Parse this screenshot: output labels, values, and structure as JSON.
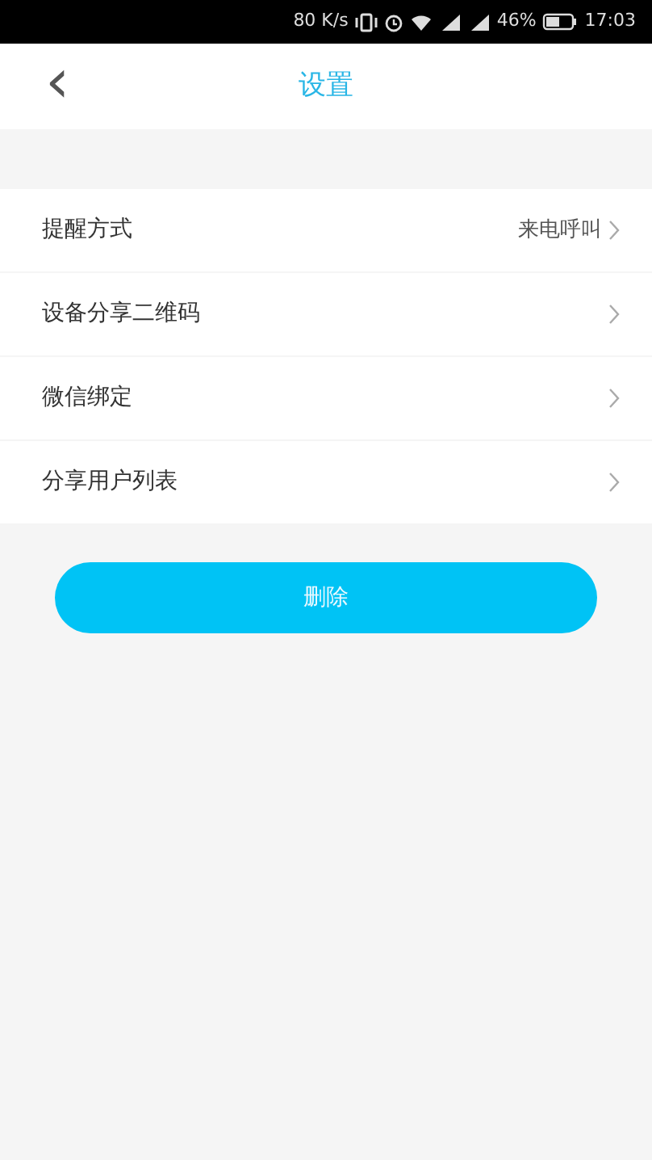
{
  "status_bar": {
    "speed": "80 K/s",
    "battery": "46%",
    "time": "17:03"
  },
  "header": {
    "back": "‹",
    "title": "设置"
  },
  "settings": [
    {
      "label": "提醒方式",
      "value": "来电呼叫"
    },
    {
      "label": "设备分享二维码"
    },
    {
      "label": "微信绑定"
    },
    {
      "label": "分享用户列表"
    }
  ],
  "button": "删除"
}
